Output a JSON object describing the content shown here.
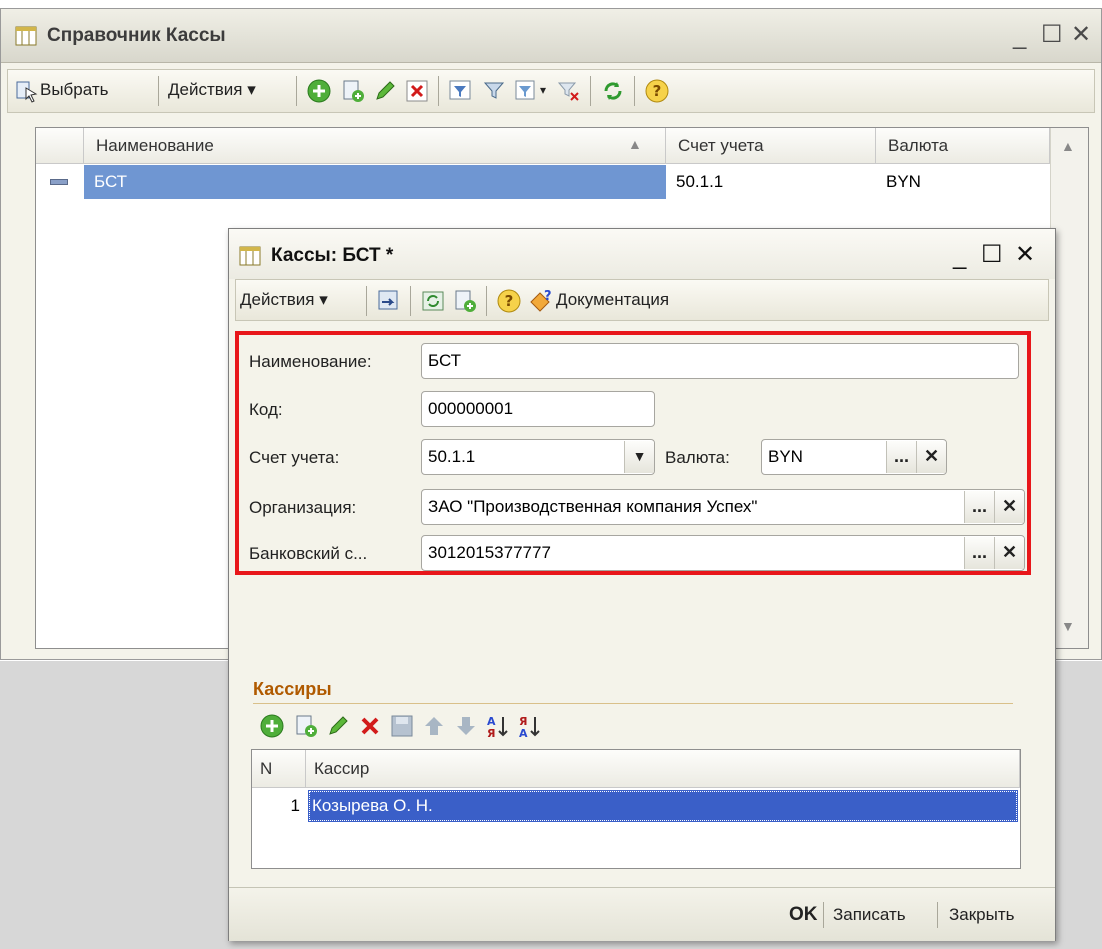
{
  "outer": {
    "title": "Справочник Кассы",
    "toolbar": {
      "select_label": "Выбрать",
      "actions_label": "Действия ▾"
    },
    "grid": {
      "columns": [
        "Наименование",
        "Счет учета",
        "Валюта"
      ],
      "rows": [
        {
          "name": "БСТ",
          "account": "50.1.1",
          "currency": "BYN"
        }
      ]
    }
  },
  "dialog": {
    "title": "Кассы: БСТ *",
    "toolbar": {
      "actions_label": "Действия ▾",
      "docs_label": "Документация"
    },
    "form": {
      "name_label": "Наименование:",
      "name_value": "БСТ",
      "code_label": "Код:",
      "code_value": "000000001",
      "account_label": "Счет учета:",
      "account_value": "50.1.1",
      "currency_label": "Валюта:",
      "currency_value": "BYN",
      "org_label": "Организация:",
      "org_value": "ЗАО \"Производственная компания Успех\"",
      "bank_label": "Банковский с...",
      "bank_value": "3012015377777"
    },
    "cashiers": {
      "title": "Кассиры",
      "columns": [
        "N",
        "Кассир"
      ],
      "rows": [
        {
          "n": "1",
          "name": "Козырева О. Н."
        }
      ]
    },
    "footer": {
      "ok_label": "OK",
      "save_label": "Записать",
      "close_label": "Закрыть"
    }
  },
  "colors": {
    "highlight": "#e8161a",
    "selection": "#3a5fc8",
    "row_select": "#6f96d2"
  }
}
